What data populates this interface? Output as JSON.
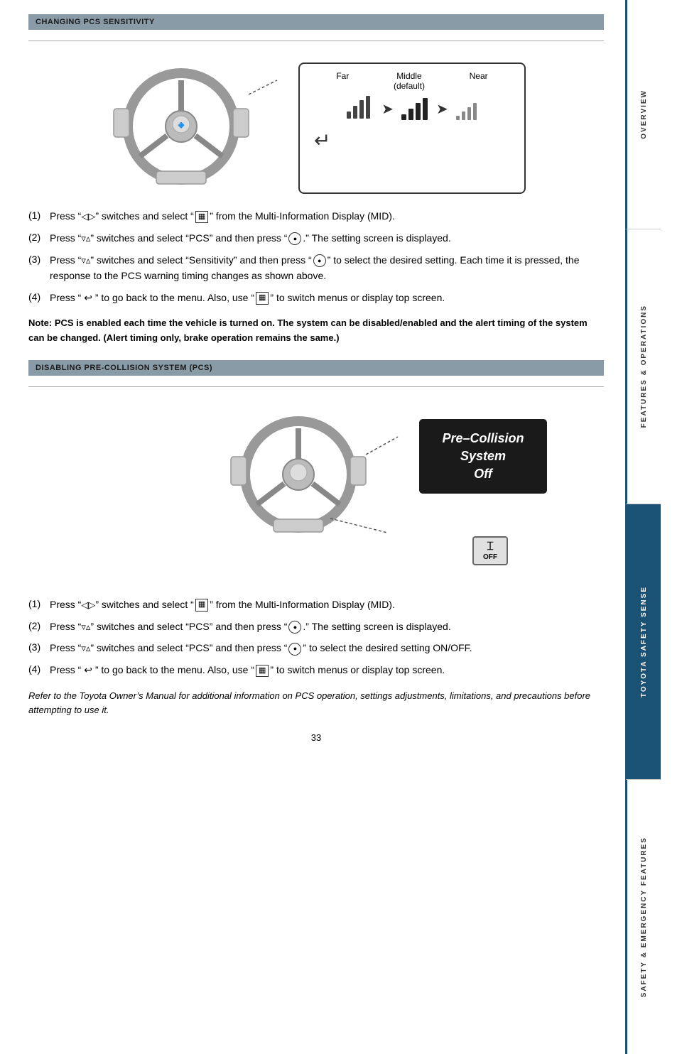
{
  "page": {
    "number": "33"
  },
  "section1": {
    "header": "CHANGING PCS SENSITIVITY",
    "sensitivity_labels": {
      "far": "Far",
      "middle": "Middle\n(default)",
      "near": "Near"
    },
    "instructions": [
      {
        "num": "(1)",
        "text": "Press “◁▷” switches and select “⊞” from the Multi-Information Display (MID)."
      },
      {
        "num": "(2)",
        "text": "Press “▽△” switches and select “PCS” and then press “●.” The setting screen is displayed."
      },
      {
        "num": "(3)",
        "text": "Press “▽△” switches and select “Sensitivity” and then press “●” to select the desired setting. Each time it is pressed, the response to the PCS warning timing changes as shown above."
      },
      {
        "num": "(4)",
        "text": "Press “ ↲ ” to go back to the menu. Also, use “⊟” to switch menus or display top screen."
      }
    ],
    "note": "Note: PCS is enabled each time the vehicle is turned on. The system can be disabled/enabled and the alert timing of the system can be changed. (Alert timing only, brake operation remains the same.)"
  },
  "section2": {
    "header": "DISABLING PRE-COLLISION SYSTEM (PCS)",
    "pcs_screen_text": "Pre–Collision\nSystem\nOff",
    "off_label": "OFF",
    "instructions": [
      {
        "num": "(1)",
        "text": "Press “◁▷” switches and select “⊞” from the Multi-Information Display (MID)."
      },
      {
        "num": "(2)",
        "text": "Press “▽△” switches and select “PCS” and then press “●.” The setting screen is displayed."
      },
      {
        "num": "(3)",
        "text": "Press “▽△” switches and select “PCS” and then press “●” to select the desired setting ON/OFF."
      },
      {
        "num": "(4)",
        "text": "Press “ ↲ ” to go back to the menu. Also, use “⊟” to switch menus or display top screen."
      }
    ],
    "italic_note": "Refer to the Toyota Owner’s Manual for additional information on PCS operation, settings adjustments, limitations, and precautions before attempting to use it."
  },
  "sidebar": {
    "sections": [
      {
        "id": "overview",
        "label": "OVERVIEW"
      },
      {
        "id": "features",
        "label": "FEATURES & OPERATIONS"
      },
      {
        "id": "toyota",
        "label": "TOYOTA SAFETY SENSE"
      },
      {
        "id": "safety",
        "label": "SAFETY & EMERGENCY FEATURES"
      }
    ]
  }
}
